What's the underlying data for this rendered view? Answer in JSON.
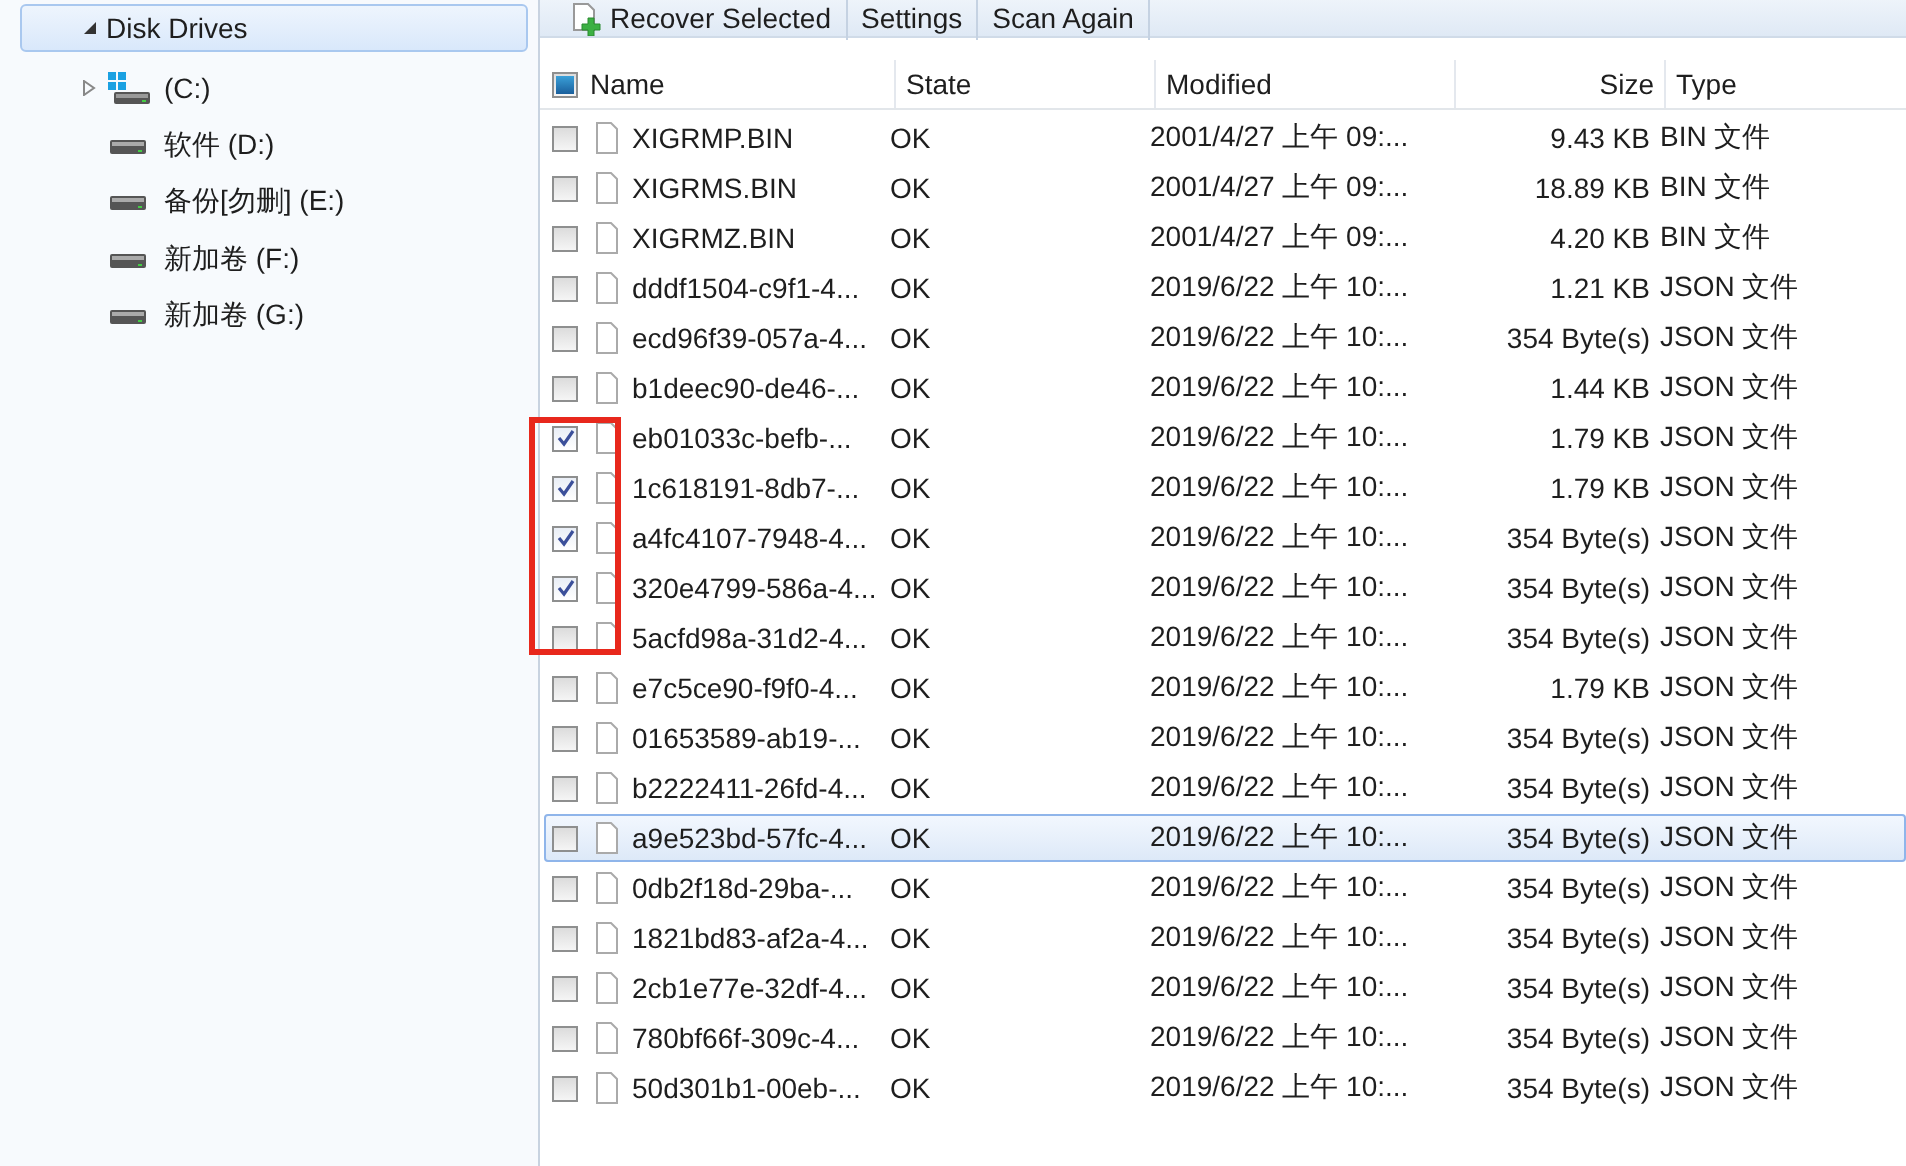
{
  "tree": [
    {
      "label": "Disk Drives",
      "expanded": true,
      "selected": true,
      "children": [
        {
          "label": "(C:)",
          "kind": "system",
          "expanded": false
        },
        {
          "label": "软件 (D:)",
          "kind": "drive"
        },
        {
          "label": "备份[勿删] (E:)",
          "kind": "drive"
        },
        {
          "label": "新加卷 (F:)",
          "kind": "drive"
        },
        {
          "label": "新加卷 (G:)",
          "kind": "drive"
        }
      ]
    }
  ],
  "toolbar": [
    {
      "label": "Recover Selected",
      "kind": "recover"
    },
    {
      "label": "Settings",
      "kind": "plain"
    },
    {
      "label": "Scan Again",
      "kind": "plain"
    }
  ],
  "table": {
    "select_all_indeterminate": true,
    "columns": [
      "Name",
      "State",
      "Modified",
      "Size",
      "Type"
    ],
    "rows": [
      {
        "checked": false,
        "selected": false,
        "name": "XIGRMP.BIN",
        "state": "OK",
        "modified": "2001/4/27 上午 09:...",
        "size": "9.43 KB",
        "type": "BIN 文件"
      },
      {
        "checked": false,
        "selected": false,
        "name": "XIGRMS.BIN",
        "state": "OK",
        "modified": "2001/4/27 上午 09:...",
        "size": "18.89 KB",
        "type": "BIN 文件"
      },
      {
        "checked": false,
        "selected": false,
        "name": "XIGRMZ.BIN",
        "state": "OK",
        "modified": "2001/4/27 上午 09:...",
        "size": "4.20 KB",
        "type": "BIN 文件"
      },
      {
        "checked": false,
        "selected": false,
        "name": "dddf1504-c9f1-4...",
        "state": "OK",
        "modified": "2019/6/22 上午 10:...",
        "size": "1.21 KB",
        "type": "JSON 文件"
      },
      {
        "checked": false,
        "selected": false,
        "name": "ecd96f39-057a-4...",
        "state": "OK",
        "modified": "2019/6/22 上午 10:...",
        "size": "354 Byte(s)",
        "type": "JSON 文件"
      },
      {
        "checked": false,
        "selected": false,
        "name": "b1deec90-de46-...",
        "state": "OK",
        "modified": "2019/6/22 上午 10:...",
        "size": "1.44 KB",
        "type": "JSON 文件"
      },
      {
        "checked": true,
        "selected": false,
        "name": "eb01033c-befb-...",
        "state": "OK",
        "modified": "2019/6/22 上午 10:...",
        "size": "1.79 KB",
        "type": "JSON 文件"
      },
      {
        "checked": true,
        "selected": false,
        "name": "1c618191-8db7-...",
        "state": "OK",
        "modified": "2019/6/22 上午 10:...",
        "size": "1.79 KB",
        "type": "JSON 文件"
      },
      {
        "checked": true,
        "selected": false,
        "name": "a4fc4107-7948-4...",
        "state": "OK",
        "modified": "2019/6/22 上午 10:...",
        "size": "354 Byte(s)",
        "type": "JSON 文件"
      },
      {
        "checked": true,
        "selected": false,
        "name": "320e4799-586a-4...",
        "state": "OK",
        "modified": "2019/6/22 上午 10:...",
        "size": "354 Byte(s)",
        "type": "JSON 文件"
      },
      {
        "checked": false,
        "selected": false,
        "name": "5acfd98a-31d2-4...",
        "state": "OK",
        "modified": "2019/6/22 上午 10:...",
        "size": "354 Byte(s)",
        "type": "JSON 文件"
      },
      {
        "checked": false,
        "selected": false,
        "name": "e7c5ce90-f9f0-4...",
        "state": "OK",
        "modified": "2019/6/22 上午 10:...",
        "size": "1.79 KB",
        "type": "JSON 文件"
      },
      {
        "checked": false,
        "selected": false,
        "name": "01653589-ab19-...",
        "state": "OK",
        "modified": "2019/6/22 上午 10:...",
        "size": "354 Byte(s)",
        "type": "JSON 文件"
      },
      {
        "checked": false,
        "selected": false,
        "name": "b2222411-26fd-4...",
        "state": "OK",
        "modified": "2019/6/22 上午 10:...",
        "size": "354 Byte(s)",
        "type": "JSON 文件"
      },
      {
        "checked": false,
        "selected": true,
        "name": "a9e523bd-57fc-4...",
        "state": "OK",
        "modified": "2019/6/22 上午 10:...",
        "size": "354 Byte(s)",
        "type": "JSON 文件"
      },
      {
        "checked": false,
        "selected": false,
        "name": "0db2f18d-29ba-...",
        "state": "OK",
        "modified": "2019/6/22 上午 10:...",
        "size": "354 Byte(s)",
        "type": "JSON 文件"
      },
      {
        "checked": false,
        "selected": false,
        "name": "1821bd83-af2a-4...",
        "state": "OK",
        "modified": "2019/6/22 上午 10:...",
        "size": "354 Byte(s)",
        "type": "JSON 文件"
      },
      {
        "checked": false,
        "selected": false,
        "name": "2cb1e77e-32df-4...",
        "state": "OK",
        "modified": "2019/6/22 上午 10:...",
        "size": "354 Byte(s)",
        "type": "JSON 文件"
      },
      {
        "checked": false,
        "selected": false,
        "name": "780bf66f-309c-4...",
        "state": "OK",
        "modified": "2019/6/22 上午 10:...",
        "size": "354 Byte(s)",
        "type": "JSON 文件"
      },
      {
        "checked": false,
        "selected": false,
        "name": "50d301b1-00eb-...",
        "state": "OK",
        "modified": "2019/6/22 上午 10:...",
        "size": "354 Byte(s)",
        "type": "JSON 文件"
      }
    ]
  }
}
